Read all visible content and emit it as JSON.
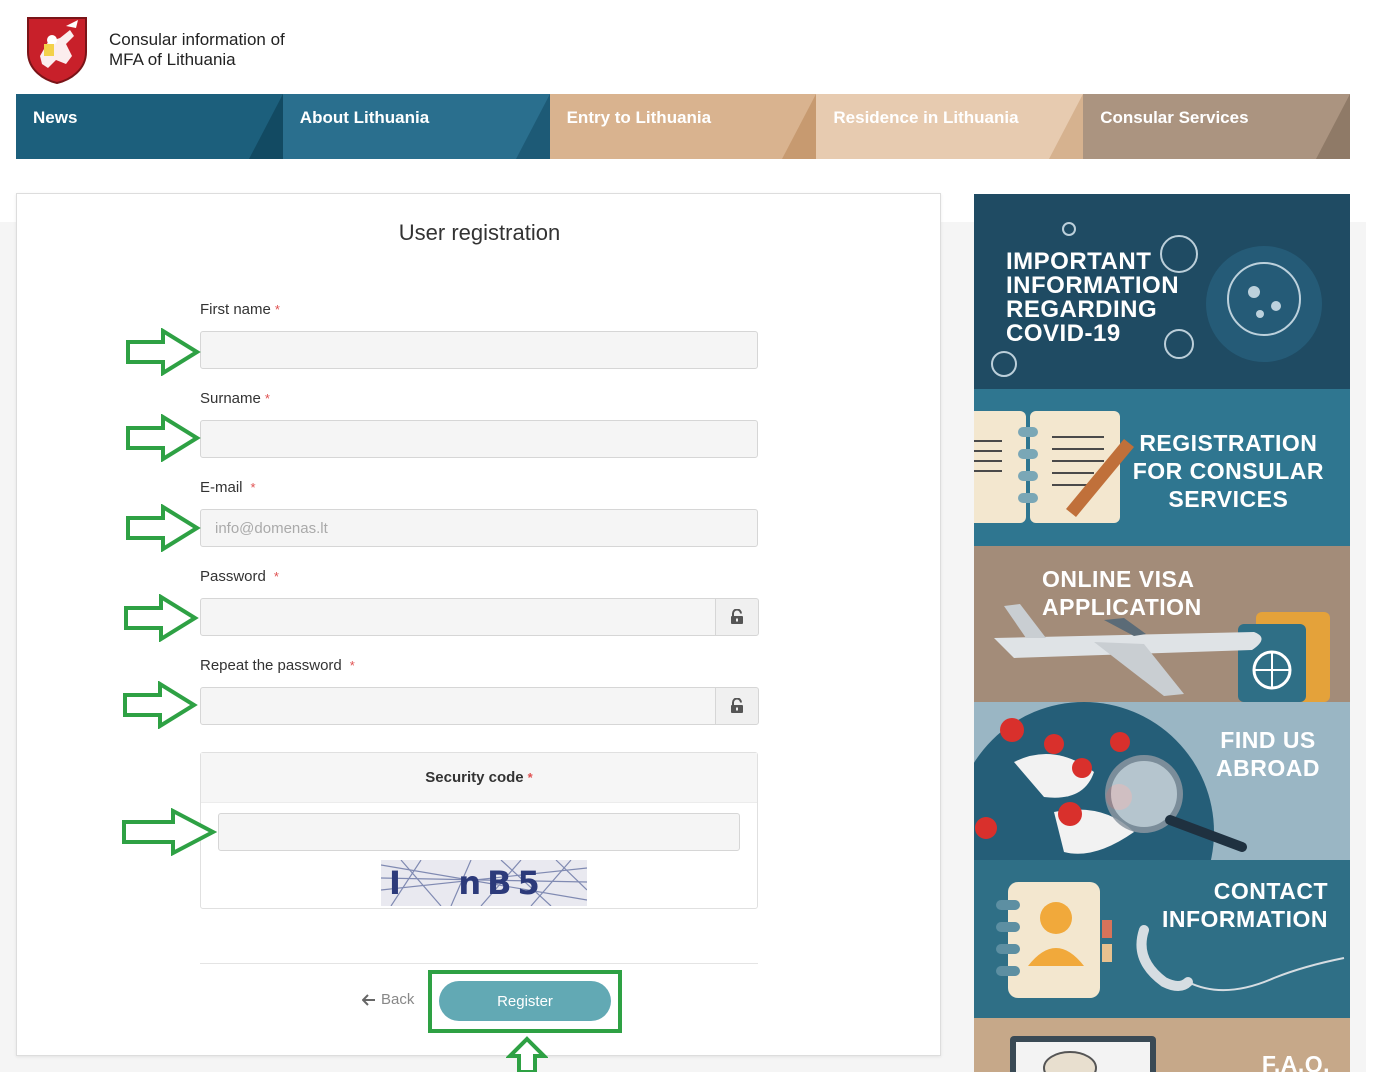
{
  "header": {
    "title_line1": "Consular information of",
    "title_line2": "MFA of Lithuania"
  },
  "nav": [
    {
      "label": "News",
      "bg": "#1c5f7c",
      "slant": "#124a62"
    },
    {
      "label": "About Lithuania",
      "bg": "#2a6f8e",
      "slant": "#1d5a76"
    },
    {
      "label": "Entry to Lithuania",
      "bg": "#d9b38f",
      "slant": "#c79a70"
    },
    {
      "label": "Residence in Lithuania",
      "bg": "#e7cbb0",
      "slant": "#d6b28f"
    },
    {
      "label": "Consular Services",
      "bg": "#ab9480",
      "slant": "#8f7a67"
    }
  ],
  "form": {
    "title": "User registration",
    "first_name_label": "First name",
    "surname_label": "Surname",
    "email_label": "E-mail",
    "email_placeholder": "info@domenas.lt",
    "password_label": "Password",
    "repeat_password_label": "Repeat the password",
    "required_mark": "*",
    "security_code_label": "Security code",
    "captcha_text": "I   nB5",
    "back_label": "Back",
    "register_label": "Register"
  },
  "banners": [
    {
      "text": "IMPORTANT INFORMATION REGARDING COVID-19",
      "lines": [
        "IMPORTANT",
        "INFORMATION",
        "REGARDING",
        "COVID-19"
      ],
      "bg": "#1f4b63"
    },
    {
      "text": "REGISTRATION FOR CONSULAR SERVICES",
      "lines": [
        "REGISTRATION",
        "FOR CONSULAR",
        "SERVICES"
      ],
      "bg": "#2f7690"
    },
    {
      "text": "ONLINE VISA APPLICATION",
      "lines": [
        "ONLINE VISA APPLICATION"
      ],
      "bg": "#a38c79"
    },
    {
      "text": "FIND US ABROAD",
      "lines": [
        "FIND US",
        "ABROAD"
      ],
      "bg": "#9ab6c4"
    },
    {
      "text": "CONTACT INFORMATION",
      "lines": [
        "CONTACT",
        "INFORMATION"
      ],
      "bg": "#2f6f86"
    },
    {
      "text": "F.A.Q.",
      "lines": [
        "F.A.Q."
      ],
      "bg": "#c6a889"
    }
  ],
  "colors": {
    "annotation_green": "#2ea144",
    "register_button": "#62a9b4",
    "required_red": "#e05050"
  },
  "icons": [
    "coat-of-arms-logo",
    "lock-icon",
    "arrow-left-icon",
    "annotation-arrow-right",
    "annotation-arrow-up"
  ]
}
